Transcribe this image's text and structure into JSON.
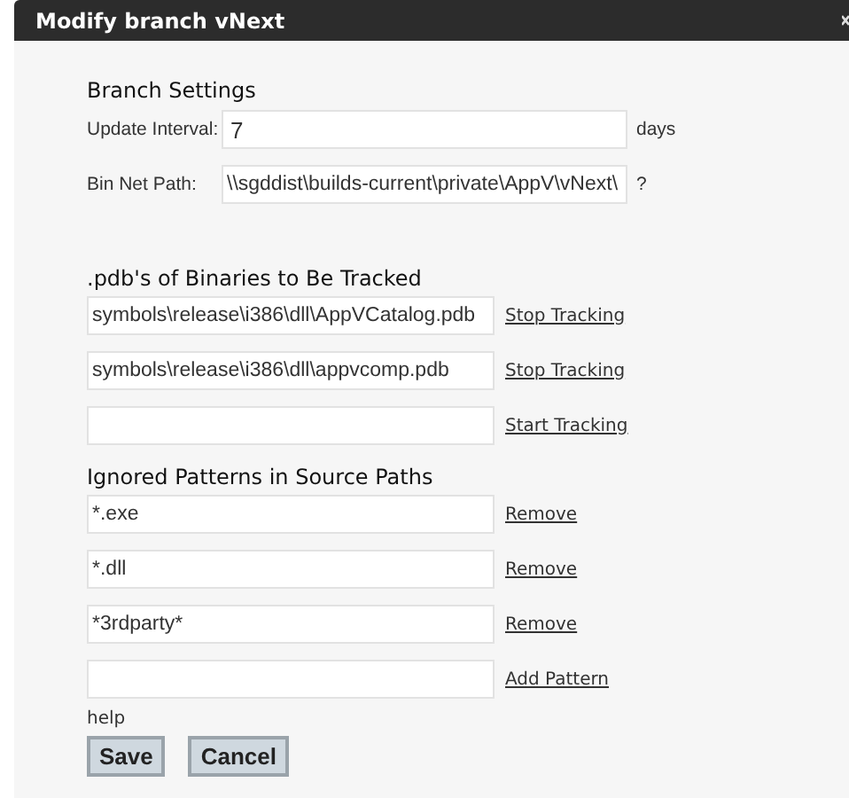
{
  "window": {
    "title": "Modify branch vNext"
  },
  "branch_settings": {
    "heading": "Branch Settings",
    "update_interval": {
      "label": "Update Interval:",
      "value": "7",
      "unit": "days"
    },
    "bin_net_path": {
      "label": "Bin Net Path:",
      "value": "\\\\sgddist\\builds-current\\private\\AppV\\vNext\\",
      "hint": "?"
    }
  },
  "tracked_pdbs": {
    "heading": ".pdb's of Binaries to Be Tracked",
    "rows": [
      {
        "value": "symbols\\release\\i386\\dll\\AppVCatalog.pdb",
        "action": "Stop Tracking"
      },
      {
        "value": "symbols\\release\\i386\\dll\\appvcomp.pdb",
        "action": "Stop Tracking"
      },
      {
        "value": "",
        "action": "Start Tracking"
      }
    ]
  },
  "ignored_patterns": {
    "heading": "Ignored Patterns in Source Paths",
    "rows": [
      {
        "value": "*.exe",
        "action": "Remove"
      },
      {
        "value": "*.dll",
        "action": "Remove"
      },
      {
        "value": "*3rdparty*",
        "action": "Remove"
      },
      {
        "value": "",
        "action": "Add Pattern"
      }
    ]
  },
  "help": "help",
  "buttons": [
    "Save",
    "Cancel"
  ]
}
